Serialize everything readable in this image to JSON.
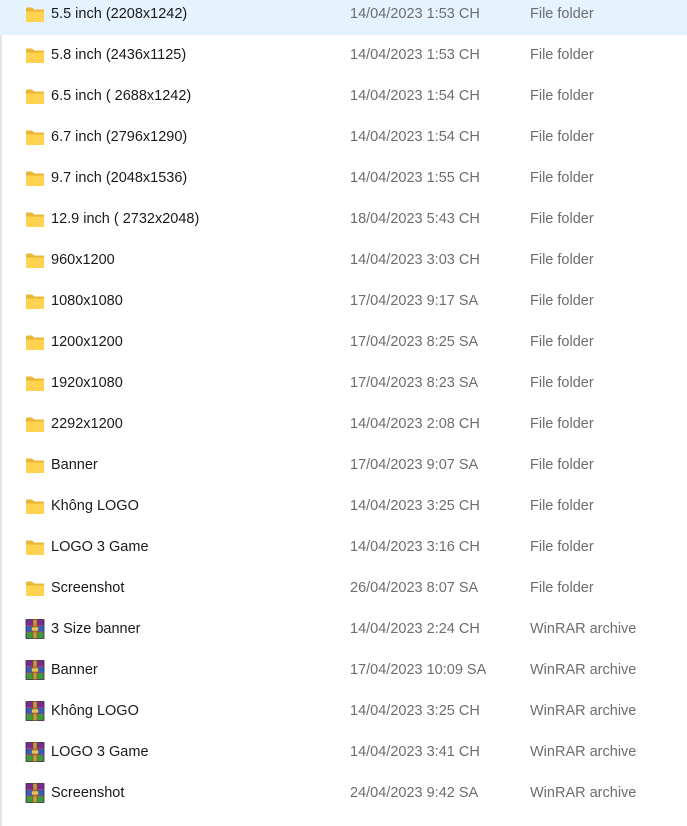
{
  "files": [
    {
      "name": "5.5 inch (2208x1242)",
      "date": "14/04/2023 1:53 CH",
      "type": "File folder",
      "icon": "folder-icon"
    },
    {
      "name": "5.8 inch (2436x1125)",
      "date": "14/04/2023 1:53 CH",
      "type": "File folder",
      "icon": "folder-icon"
    },
    {
      "name": "6.5 inch ( 2688x1242)",
      "date": "14/04/2023 1:54 CH",
      "type": "File folder",
      "icon": "folder-icon"
    },
    {
      "name": "6.7 inch (2796x1290)",
      "date": "14/04/2023 1:54 CH",
      "type": "File folder",
      "icon": "folder-icon"
    },
    {
      "name": "9.7 inch (2048x1536)",
      "date": "14/04/2023 1:55 CH",
      "type": "File folder",
      "icon": "folder-icon"
    },
    {
      "name": "12.9 inch ( 2732x2048)",
      "date": "18/04/2023 5:43 CH",
      "type": "File folder",
      "icon": "folder-icon"
    },
    {
      "name": "960x1200",
      "date": "14/04/2023 3:03 CH",
      "type": "File folder",
      "icon": "folder-icon"
    },
    {
      "name": "1080x1080",
      "date": "17/04/2023 9:17 SA",
      "type": "File folder",
      "icon": "folder-icon"
    },
    {
      "name": "1200x1200",
      "date": "17/04/2023 8:25 SA",
      "type": "File folder",
      "icon": "folder-icon"
    },
    {
      "name": "1920x1080",
      "date": "17/04/2023 8:23 SA",
      "type": "File folder",
      "icon": "folder-icon"
    },
    {
      "name": "2292x1200",
      "date": "14/04/2023 2:08 CH",
      "type": "File folder",
      "icon": "folder-icon"
    },
    {
      "name": "Banner",
      "date": "17/04/2023 9:07 SA",
      "type": "File folder",
      "icon": "folder-icon"
    },
    {
      "name": "Không LOGO",
      "date": "14/04/2023 3:25 CH",
      "type": "File folder",
      "icon": "folder-icon"
    },
    {
      "name": "LOGO 3 Game",
      "date": "14/04/2023 3:16 CH",
      "type": "File folder",
      "icon": "folder-icon"
    },
    {
      "name": "Screenshot",
      "date": "26/04/2023 8:07 SA",
      "type": "File folder",
      "icon": "folder-icon"
    },
    {
      "name": "3 Size banner",
      "date": "14/04/2023 2:24 CH",
      "type": "WinRAR archive",
      "icon": "winrar-archive-icon"
    },
    {
      "name": "Banner",
      "date": "17/04/2023 10:09 SA",
      "type": "WinRAR archive",
      "icon": "winrar-archive-icon"
    },
    {
      "name": "Không LOGO",
      "date": "14/04/2023 3:25 CH",
      "type": "WinRAR archive",
      "icon": "winrar-archive-icon"
    },
    {
      "name": "LOGO 3 Game",
      "date": "14/04/2023 3:41 CH",
      "type": "WinRAR archive",
      "icon": "winrar-archive-icon"
    },
    {
      "name": "Screenshot",
      "date": "24/04/2023 9:42 SA",
      "type": "WinRAR archive",
      "icon": "winrar-archive-icon"
    }
  ],
  "colors": {
    "folder_back": "#e8b73a",
    "folder_front": "#ffd24f",
    "text_primary": "#1a1a1a",
    "text_secondary": "#6d6d6d",
    "hover": "#e5f3ff"
  }
}
